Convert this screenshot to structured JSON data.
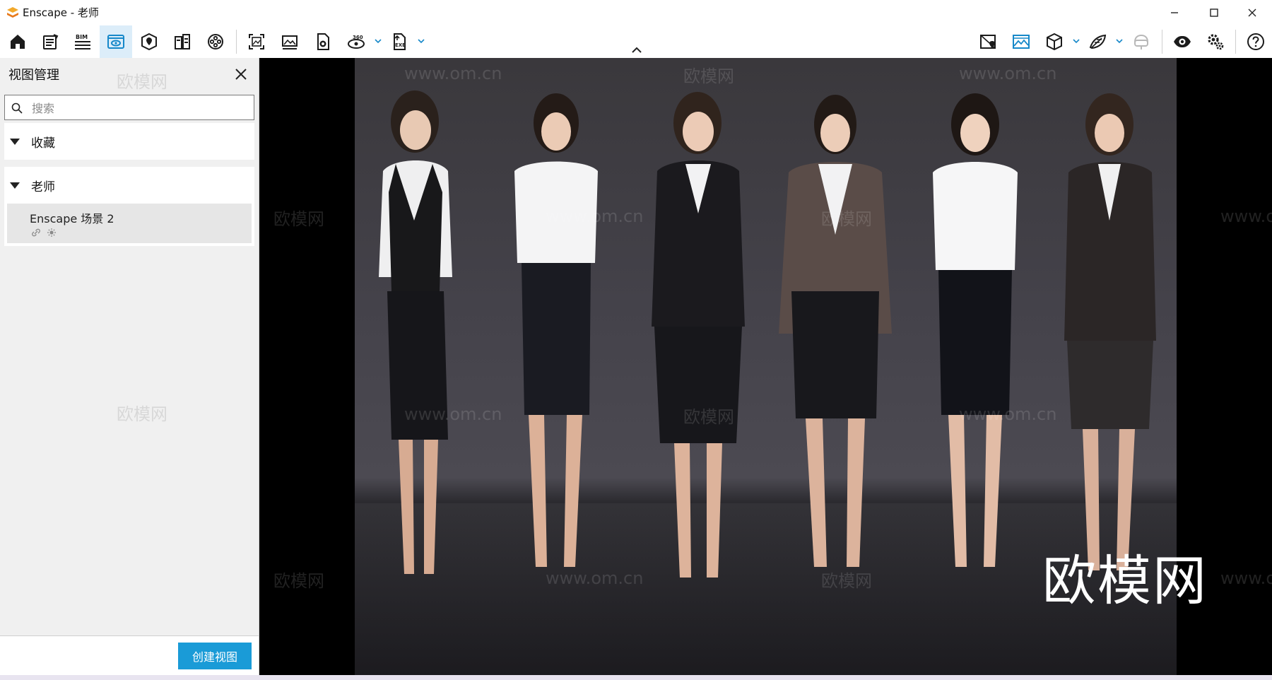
{
  "window": {
    "title": "Enscape - 老师",
    "controls": [
      "minimize-icon",
      "maximize-icon",
      "close-icon"
    ]
  },
  "toolbar": {
    "left_icons": [
      "home-icon",
      "notes-icon",
      "bim-icon",
      "view-management-icon",
      "site-context-icon",
      "material-icon",
      "video-editor-icon",
      "screenshot-icon",
      "batch-render-icon",
      "panorama-icon",
      "render-360-icon",
      "export-exe-icon"
    ],
    "bim_label": "BIM",
    "pano_label": "360",
    "exe_label": "EXE",
    "right_icons": [
      "map-icon",
      "render-image-icon",
      "cube-icon",
      "asset-library-icon",
      "vr-headset-icon",
      "visibility-icon",
      "settings-icon",
      "help-icon"
    ],
    "active": "view-management-icon"
  },
  "panel": {
    "title": "视图管理",
    "search_placeholder": "搜索",
    "sections": [
      {
        "label": "收藏",
        "items": []
      },
      {
        "label": "老师",
        "items": [
          {
            "name": "Enscape 场景 2",
            "icons": [
              "link-icon",
              "sun-icon"
            ]
          }
        ]
      }
    ],
    "create_button": "创建视图"
  },
  "viewport": {
    "watermark_text": "欧模网",
    "watermark_url": "www.om.cn",
    "logo_text": "欧模网"
  },
  "colors": {
    "accent": "#1a9bd7",
    "active_tab_bg": "#dcedf9",
    "panel_bg": "#f0f0f0"
  }
}
